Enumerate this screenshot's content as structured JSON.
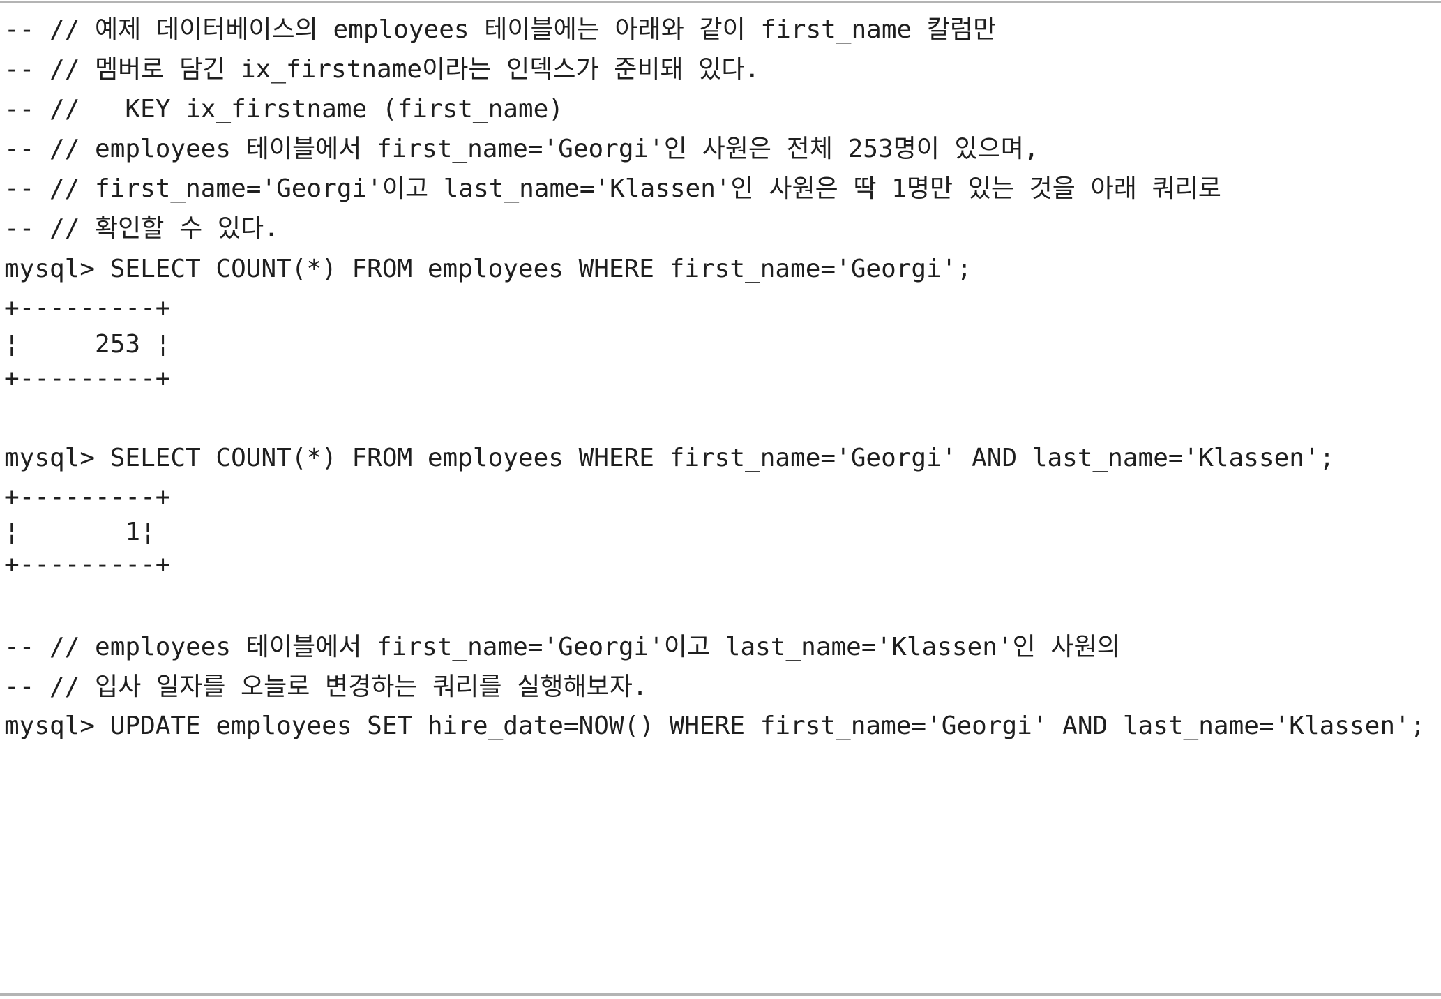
{
  "code_listing": {
    "lines": [
      "-- // 예제 데이터베이스의 employees 테이블에는 아래와 같이 first_name 칼럼만",
      "-- // 멤버로 담긴 ix_firstname이라는 인덱스가 준비돼 있다.",
      "-- //   KEY ix_firstname (first_name)",
      "-- // employees 테이블에서 first_name='Georgi'인 사원은 전체 253명이 있으며,",
      "-- // first_name='Georgi'이고 last_name='Klassen'인 사원은 딱 1명만 있는 것을 아래 쿼리로",
      "-- // 확인할 수 있다.",
      "mysql> SELECT COUNT(*) FROM employees WHERE first_name='Georgi';",
      "+---------+",
      "¦     253 ¦",
      "+---------+",
      "mysql> SELECT COUNT(*) FROM employees WHERE first_name='Georgi' AND last_name='Klassen';",
      "+---------+",
      "¦       1¦",
      "+---------+",
      "-- // employees 테이블에서 first_name='Georgi'이고 last_name='Klassen'인 사원의",
      "-- // 입사 일자를 오늘로 변경하는 쿼리를 실행해보자.",
      "mysql> UPDATE employees SET hire_date=NOW() WHERE first_name='Georgi' AND last_name='Klassen';"
    ]
  }
}
